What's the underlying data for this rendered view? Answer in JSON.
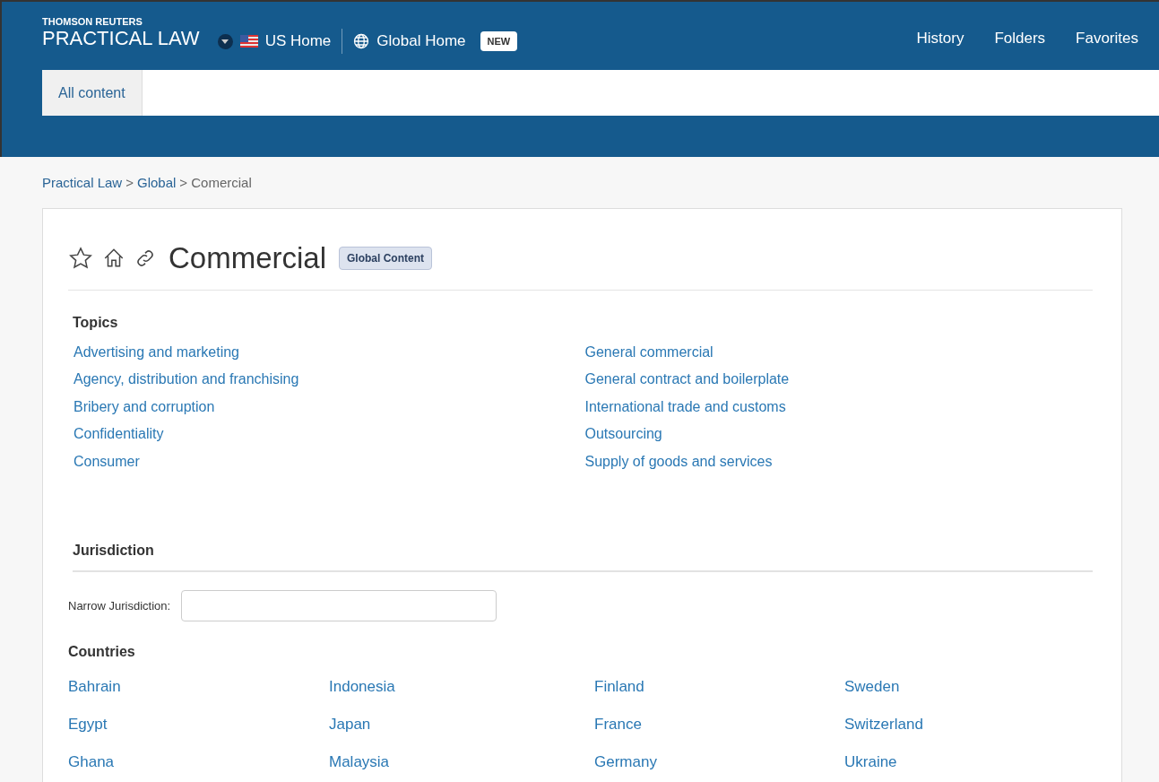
{
  "header": {
    "brand_top": "THOMSON REUTERS",
    "brand": "PRACTICAL LAW",
    "home_links": [
      {
        "label": "US Home"
      },
      {
        "label": "Global Home"
      }
    ],
    "badge": "NEW",
    "nav": [
      "History",
      "Folders",
      "Favorites"
    ],
    "search": {
      "scope": "All content"
    }
  },
  "breadcrumb": [
    {
      "label": "Practical Law",
      "link": true
    },
    {
      "label": ">",
      "link": false
    },
    {
      "label": "Global",
      "link": true
    },
    {
      "label": "> Comercial",
      "link": false
    }
  ],
  "page": {
    "title": "Commercial",
    "tag": "Global Content",
    "favorite": false
  },
  "topics": {
    "heading": "Topics",
    "columns": [
      [
        "Advertising and marketing",
        "Agency, distribution and franchising",
        "Bribery and corruption",
        "Confidentiality",
        "Consumer"
      ],
      [
        "General commercial",
        "General contract and boilerplate",
        "International trade and customs",
        "Outsourcing",
        "Supply of goods and services"
      ]
    ]
  },
  "jurisdiction": {
    "heading": "Jurisdiction",
    "filter_label": "Narrow Jurisdiction:",
    "countries_heading": "Countries",
    "countries": [
      "Bahrain",
      "Indonesia",
      "Finland",
      "Sweden",
      "Egypt",
      "Japan",
      "France",
      "Switzerland",
      "Ghana",
      "Malaysia",
      "Germany",
      "Ukraine"
    ]
  }
}
